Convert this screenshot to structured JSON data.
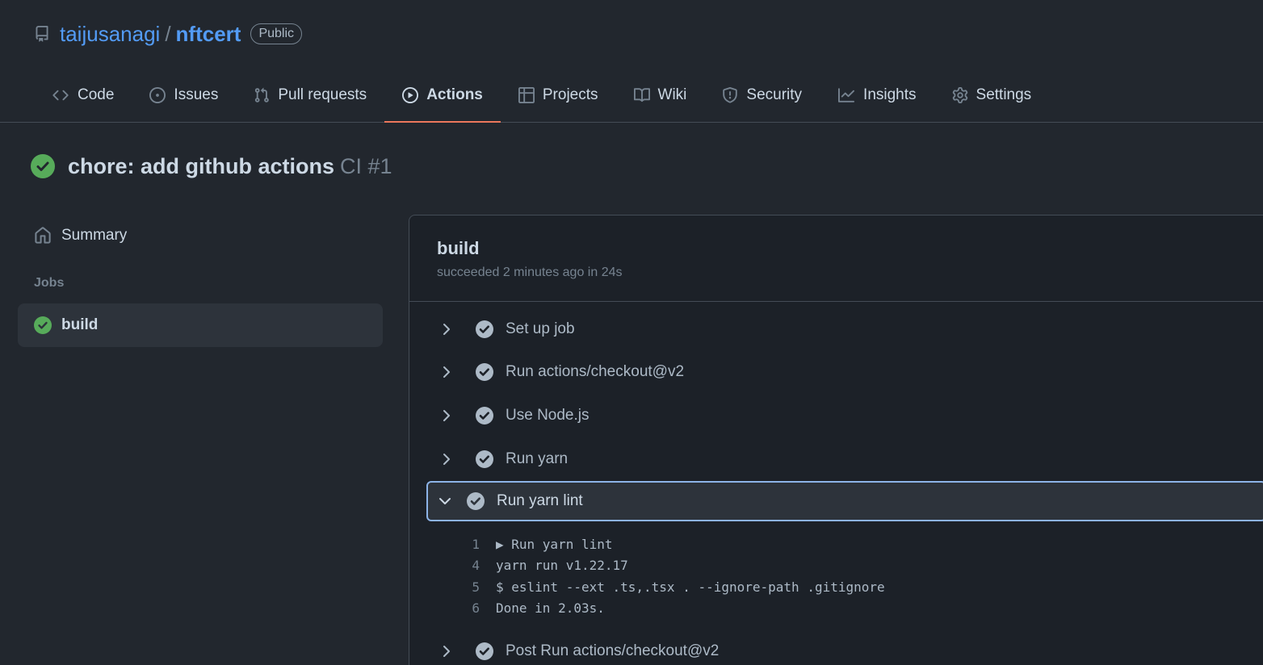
{
  "repo": {
    "owner": "taijusanagi",
    "separator": "/",
    "name": "nftcert",
    "visibility": "Public"
  },
  "tabs": [
    {
      "label": "Code",
      "icon": "code-icon"
    },
    {
      "label": "Issues",
      "icon": "issue-icon"
    },
    {
      "label": "Pull requests",
      "icon": "pull-request-icon"
    },
    {
      "label": "Actions",
      "icon": "play-icon",
      "active": true
    },
    {
      "label": "Projects",
      "icon": "table-icon"
    },
    {
      "label": "Wiki",
      "icon": "book-icon"
    },
    {
      "label": "Security",
      "icon": "shield-icon"
    },
    {
      "label": "Insights",
      "icon": "graph-icon"
    },
    {
      "label": "Settings",
      "icon": "gear-icon"
    }
  ],
  "run": {
    "title": "chore: add github actions",
    "workflow": "CI #1",
    "status_color": "#57ab5a"
  },
  "sidebar": {
    "summary_label": "Summary",
    "jobs_label": "Jobs",
    "jobs": [
      {
        "name": "build"
      }
    ]
  },
  "job": {
    "name": "build",
    "meta": "succeeded 2 minutes ago in 24s"
  },
  "steps": [
    {
      "label": "Set up job"
    },
    {
      "label": "Run actions/checkout@v2"
    },
    {
      "label": "Use Node.js"
    },
    {
      "label": "Run yarn"
    },
    {
      "label": "Run yarn lint",
      "expanded": true
    },
    {
      "label": "Post Run actions/checkout@v2"
    }
  ],
  "log": [
    {
      "n": "1",
      "text": "▶ Run yarn lint"
    },
    {
      "n": "4",
      "text": "yarn run v1.22.17"
    },
    {
      "n": "5",
      "text": "$ eslint --ext .ts,.tsx . --ignore-path .gitignore"
    },
    {
      "n": "6",
      "text": "Done in 2.03s."
    }
  ]
}
